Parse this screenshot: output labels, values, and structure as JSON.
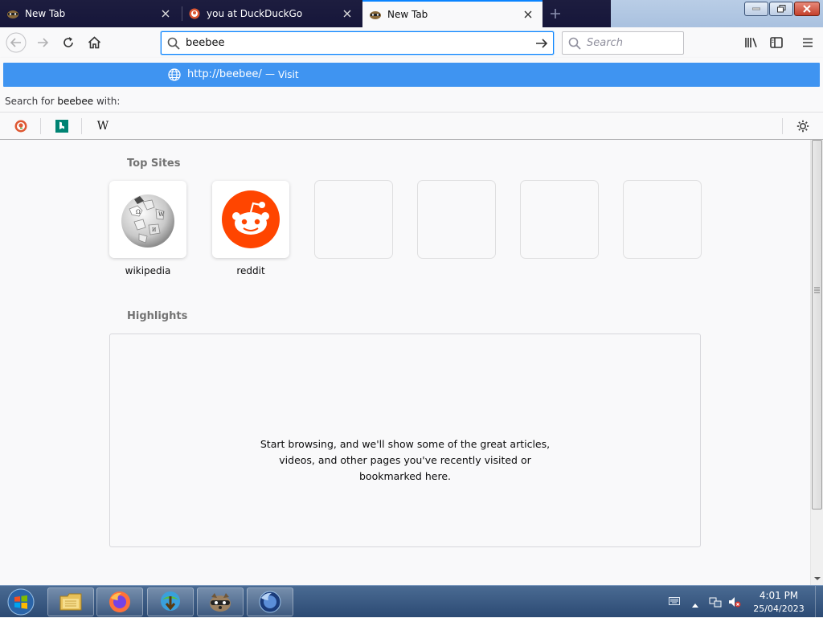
{
  "tabs": [
    {
      "title": "New Tab",
      "icon": "raccoon-icon",
      "active": false
    },
    {
      "title": "you at DuckDuckGo",
      "icon": "duckduckgo-icon",
      "active": false
    },
    {
      "title": "New Tab",
      "icon": "raccoon-icon",
      "active": true
    }
  ],
  "navbar": {
    "url_value": "beebee",
    "search_placeholder": "Search"
  },
  "autocomplete": {
    "suggestion_url": "http://beebee/",
    "suggestion_dash": "—",
    "suggestion_action": "Visit",
    "search_for_prefix": "Search for ",
    "search_for_term": "beebee",
    "search_for_suffix": " with:",
    "engines": [
      "duckduckgo-icon",
      "bing-icon",
      "wikipedia-icon"
    ]
  },
  "content": {
    "top_sites_title": "Top Sites",
    "top_sites": [
      {
        "label": "wikipedia",
        "icon": "wikipedia-globe-icon"
      },
      {
        "label": "reddit",
        "icon": "reddit-icon"
      },
      {
        "label": ""
      },
      {
        "label": ""
      },
      {
        "label": ""
      },
      {
        "label": ""
      }
    ],
    "highlights_title": "Highlights",
    "highlights_line1": "Start browsing, and we'll show some of the great articles,",
    "highlights_line2": "videos, and other pages you've recently visited or",
    "highlights_line3": "bookmarked here."
  },
  "taskbar": {
    "time": "4:01 PM",
    "date": "25/04/2023",
    "apps": [
      "file-explorer-icon",
      "firefox-icon",
      "idm-icon",
      "raccoon-app-icon",
      "firefox-nightly-icon"
    ]
  },
  "colors": {
    "accent": "#0a84ff",
    "suggestion_bg": "#3f94f1",
    "tabstrip_bg": "#1d1d3f",
    "reddit": "#ff4500"
  }
}
